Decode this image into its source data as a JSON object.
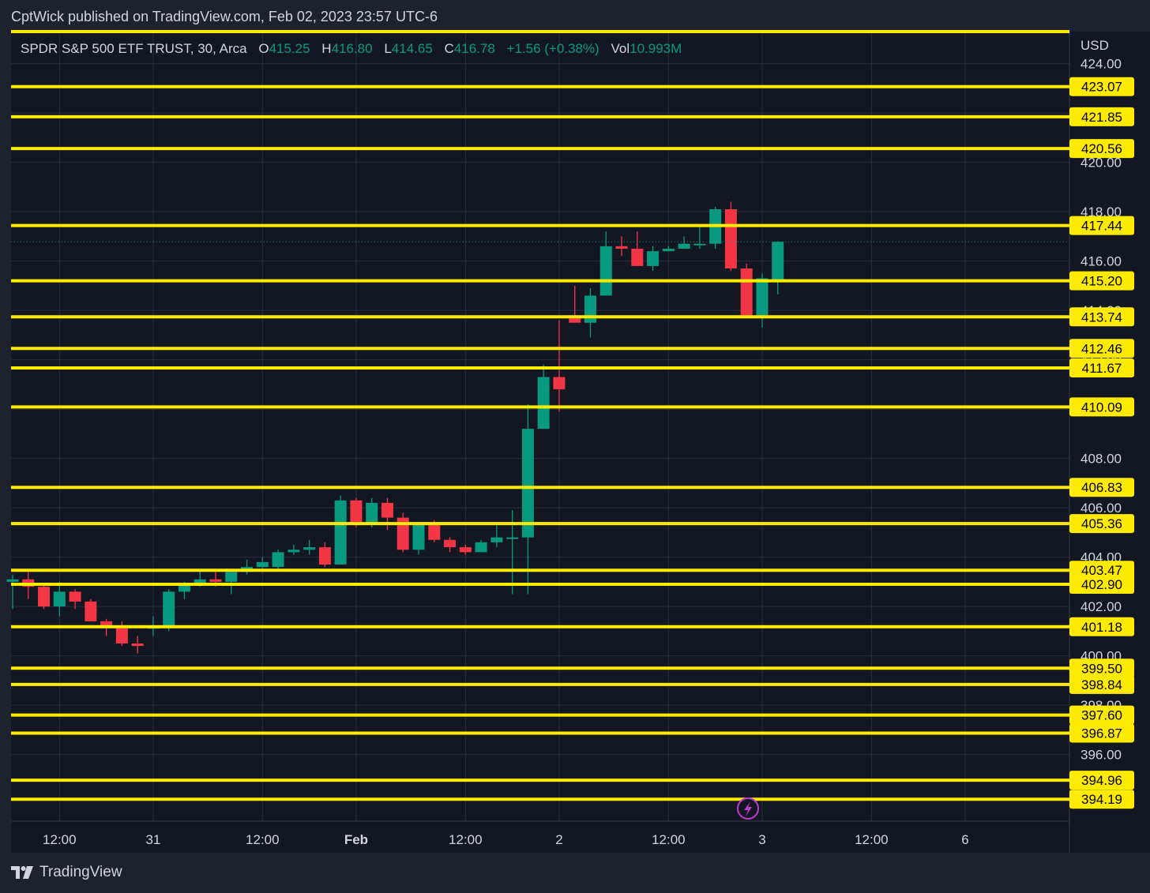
{
  "header": {
    "publisher_line": "CptWick published on TradingView.com, Feb 02, 2023 23:57 UTC-6"
  },
  "legend": {
    "symbol": "SPDR S&P 500 ETF TRUST, 30, Arca",
    "o_label": "O",
    "o_value": "415.25",
    "h_label": "H",
    "h_value": "416.80",
    "l_label": "L",
    "l_value": "414.65",
    "c_label": "C",
    "c_value": "416.78",
    "change": "+1.56 (+0.38%)",
    "vol_label": "Vol",
    "vol_value": "10.993M"
  },
  "currency": "USD",
  "footer": {
    "brand": "TradingView"
  },
  "colors": {
    "background": "#1e222d",
    "pane": "#131722",
    "grid": "#2a2e39",
    "up": "#089981",
    "down": "#f23645",
    "level_line": "#ffeb00",
    "text": "#d1d4dc"
  },
  "chart_data": {
    "type": "candlestick",
    "symbol": "SPY",
    "timeframe": "30",
    "ylim": [
      393.3,
      425.3
    ],
    "price_ticks": [
      "424.00",
      "422.00",
      "420.00",
      "418.00",
      "416.00",
      "414.00",
      "412.00",
      "410.00",
      "408.00",
      "406.00",
      "404.00",
      "402.00",
      "400.00",
      "398.00",
      "396.00"
    ],
    "time_ticks": [
      {
        "label": "12:00",
        "bar": 3
      },
      {
        "label": "31",
        "bar": 9
      },
      {
        "label": "12:00",
        "bar": 16
      },
      {
        "label": "Feb",
        "bar": 22,
        "bold": true
      },
      {
        "label": "12:00",
        "bar": 29
      },
      {
        "label": "2",
        "bar": 35
      },
      {
        "label": "12:00",
        "bar": 42
      },
      {
        "label": "3",
        "bar": 48
      },
      {
        "label": "12:00",
        "bar": 55
      },
      {
        "label": "6",
        "bar": 61
      }
    ],
    "horizontal_levels": [
      423.07,
      421.85,
      420.56,
      417.44,
      415.2,
      413.74,
      412.46,
      411.67,
      410.09,
      406.83,
      405.36,
      403.47,
      402.9,
      401.18,
      399.5,
      398.84,
      397.6,
      396.87,
      394.96,
      394.19
    ],
    "level_labels": [
      "423.07",
      "421.85",
      "420.56",
      "417.44",
      "415.20",
      "413.74",
      "412.46",
      "411.67",
      "410.09",
      "406.83",
      "405.36",
      "403.47",
      "402.90",
      "401.18",
      "399.50",
      "398.84",
      "397.60",
      "396.87",
      "394.96",
      "394.19"
    ],
    "last_price": 416.78,
    "candles": [
      {
        "o": 403.0,
        "h": 403.3,
        "l": 401.9,
        "c": 403.1
      },
      {
        "o": 403.1,
        "h": 403.4,
        "l": 402.3,
        "c": 402.8
      },
      {
        "o": 402.8,
        "h": 402.9,
        "l": 401.9,
        "c": 402.0
      },
      {
        "o": 402.0,
        "h": 403.0,
        "l": 401.6,
        "c": 402.6
      },
      {
        "o": 402.6,
        "h": 402.7,
        "l": 401.9,
        "c": 402.2
      },
      {
        "o": 402.2,
        "h": 402.3,
        "l": 401.4,
        "c": 401.4
      },
      {
        "o": 401.4,
        "h": 401.5,
        "l": 400.8,
        "c": 401.2
      },
      {
        "o": 401.2,
        "h": 401.4,
        "l": 400.4,
        "c": 400.5
      },
      {
        "o": 400.5,
        "h": 400.8,
        "l": 400.1,
        "c": 400.4
      },
      {
        "o": 401.1,
        "h": 401.6,
        "l": 400.8,
        "c": 401.2
      },
      {
        "o": 401.2,
        "h": 402.7,
        "l": 401.0,
        "c": 402.6
      },
      {
        "o": 402.6,
        "h": 403.0,
        "l": 402.3,
        "c": 402.9
      },
      {
        "o": 402.9,
        "h": 403.5,
        "l": 402.8,
        "c": 403.1
      },
      {
        "o": 403.1,
        "h": 403.4,
        "l": 402.8,
        "c": 403.0
      },
      {
        "o": 403.0,
        "h": 403.4,
        "l": 402.5,
        "c": 403.4
      },
      {
        "o": 403.4,
        "h": 403.9,
        "l": 403.3,
        "c": 403.6
      },
      {
        "o": 403.6,
        "h": 404.0,
        "l": 403.4,
        "c": 403.8
      },
      {
        "o": 403.6,
        "h": 404.3,
        "l": 403.5,
        "c": 404.2
      },
      {
        "o": 404.2,
        "h": 404.5,
        "l": 404.1,
        "c": 404.3
      },
      {
        "o": 404.3,
        "h": 404.7,
        "l": 404.1,
        "c": 404.4
      },
      {
        "o": 404.4,
        "h": 404.6,
        "l": 403.6,
        "c": 403.7
      },
      {
        "o": 403.7,
        "h": 406.5,
        "l": 403.7,
        "c": 406.3
      },
      {
        "o": 406.3,
        "h": 406.4,
        "l": 405.2,
        "c": 405.3
      },
      {
        "o": 405.3,
        "h": 406.4,
        "l": 405.2,
        "c": 406.2
      },
      {
        "o": 406.2,
        "h": 406.4,
        "l": 405.1,
        "c": 405.6
      },
      {
        "o": 405.6,
        "h": 405.8,
        "l": 404.2,
        "c": 404.3
      },
      {
        "o": 404.3,
        "h": 405.4,
        "l": 404.1,
        "c": 405.4
      },
      {
        "o": 405.4,
        "h": 405.5,
        "l": 404.6,
        "c": 404.7
      },
      {
        "o": 404.7,
        "h": 404.8,
        "l": 404.2,
        "c": 404.4
      },
      {
        "o": 404.4,
        "h": 404.5,
        "l": 404.1,
        "c": 404.2
      },
      {
        "o": 404.2,
        "h": 404.7,
        "l": 404.2,
        "c": 404.6
      },
      {
        "o": 404.6,
        "h": 405.4,
        "l": 404.4,
        "c": 404.8
      },
      {
        "o": 404.8,
        "h": 405.9,
        "l": 402.5,
        "c": 404.8
      },
      {
        "o": 404.8,
        "h": 410.2,
        "l": 402.5,
        "c": 409.2
      },
      {
        "o": 409.2,
        "h": 411.8,
        "l": 409.2,
        "c": 411.3
      },
      {
        "o": 411.3,
        "h": 413.6,
        "l": 409.9,
        "c": 410.8
      },
      {
        "o": 413.8,
        "h": 415.0,
        "l": 413.5,
        "c": 413.5
      },
      {
        "o": 413.5,
        "h": 414.9,
        "l": 412.9,
        "c": 414.6
      },
      {
        "o": 414.6,
        "h": 417.2,
        "l": 414.6,
        "c": 416.6
      },
      {
        "o": 416.6,
        "h": 417.0,
        "l": 416.2,
        "c": 416.5
      },
      {
        "o": 416.5,
        "h": 417.2,
        "l": 415.8,
        "c": 415.8
      },
      {
        "o": 415.8,
        "h": 416.6,
        "l": 415.6,
        "c": 416.4
      },
      {
        "o": 416.4,
        "h": 416.6,
        "l": 416.4,
        "c": 416.5
      },
      {
        "o": 416.5,
        "h": 417.0,
        "l": 416.5,
        "c": 416.7
      },
      {
        "o": 416.7,
        "h": 417.4,
        "l": 416.5,
        "c": 416.7
      },
      {
        "o": 416.7,
        "h": 418.2,
        "l": 416.5,
        "c": 418.1
      },
      {
        "o": 418.1,
        "h": 418.4,
        "l": 415.6,
        "c": 415.7
      },
      {
        "o": 415.7,
        "h": 415.9,
        "l": 413.8,
        "c": 413.8
      },
      {
        "o": 413.8,
        "h": 415.5,
        "l": 413.3,
        "c": 415.3
      },
      {
        "o": 415.25,
        "h": 416.8,
        "l": 414.65,
        "c": 416.78
      }
    ]
  }
}
